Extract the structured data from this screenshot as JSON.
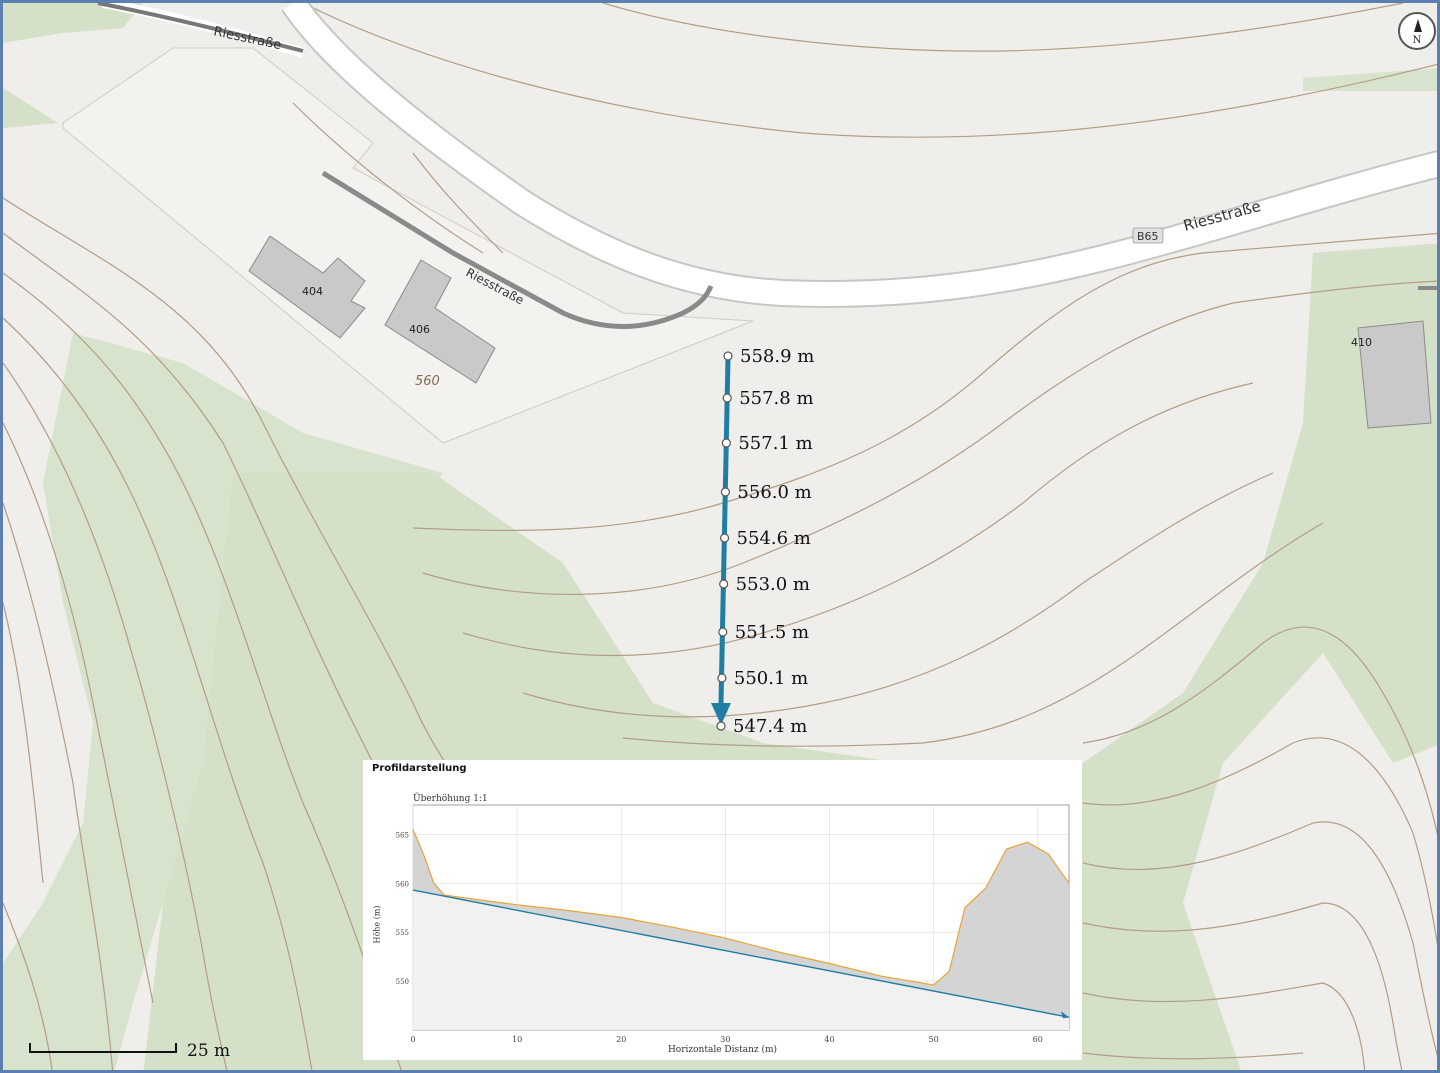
{
  "map": {
    "streets": [
      {
        "name": "Riesstraße",
        "role": "upper-left"
      },
      {
        "name": "Riesstraße",
        "role": "right"
      },
      {
        "name": "Riesstraße",
        "role": "access-road"
      }
    ],
    "road_badge": "B65",
    "buildings": [
      "404",
      "406",
      "410"
    ],
    "contour_label": "560",
    "north_label": "N",
    "scale_label": "25 m",
    "colors": {
      "background": "#efeeea",
      "forest": "#d4e1c8",
      "contour": "#b49c87",
      "building": "#c9c9c9",
      "route": "#1f7ea1",
      "frame": "#5b7fb0"
    }
  },
  "elevation_points": [
    "558.9 m",
    "557.8 m",
    "557.1 m",
    "556.0 m",
    "554.6 m",
    "553.0 m",
    "551.5 m",
    "550.1 m",
    "547.4 m"
  ],
  "profile": {
    "title": "Profildarstellung",
    "subtitle": "Überhöhung 1:1",
    "ylabel": "Höhe (m)",
    "xlabel": "Horizontale Distanz (m)"
  },
  "chart_data": {
    "type": "area",
    "title": "Profildarstellung",
    "subtitle": "Überhöhung 1:1",
    "xlabel": "Horizontale Distanz (m)",
    "ylabel": "Höhe (m)",
    "xlim": [
      0,
      63
    ],
    "ylim": [
      545,
      568
    ],
    "x_ticks": [
      0,
      10,
      20,
      30,
      40,
      50,
      60
    ],
    "y_ticks": [
      550,
      555,
      560,
      565
    ],
    "grid": true,
    "series": [
      {
        "role": "terrain",
        "color": "#e8a33a",
        "fill": "#d4d4d4",
        "x": [
          0,
          1,
          2,
          3,
          5,
          10,
          15,
          20,
          25,
          30,
          35,
          40,
          45,
          50,
          51.5,
          53,
          55,
          57,
          59,
          61,
          62,
          63
        ],
        "y": [
          565.5,
          563,
          560,
          558.8,
          558.5,
          557.8,
          557.2,
          556.5,
          555.5,
          554.4,
          553.0,
          551.8,
          550.5,
          549.6,
          551.0,
          557.5,
          559.5,
          563.5,
          564.2,
          563.0,
          561.5,
          560.0
        ]
      },
      {
        "role": "line-of-sight",
        "color": "#1f7ea1",
        "x": [
          0,
          63
        ],
        "y": [
          559.3,
          546.3
        ]
      }
    ]
  }
}
